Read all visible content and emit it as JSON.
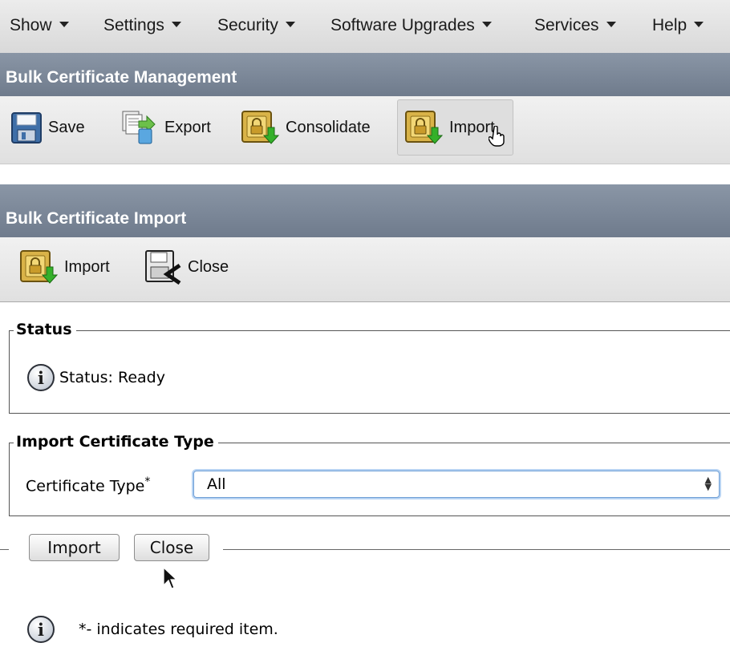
{
  "menu": {
    "items": [
      {
        "label": "Show"
      },
      {
        "label": "Settings"
      },
      {
        "label": "Security"
      },
      {
        "label": "Software Upgrades"
      },
      {
        "label": "Services"
      },
      {
        "label": "Help"
      }
    ]
  },
  "management": {
    "title": "Bulk Certificate Management",
    "toolbar": {
      "save_label": "Save",
      "export_label": "Export",
      "consolidate_label": "Consolidate",
      "import_label": "Import"
    }
  },
  "import_panel": {
    "title": "Bulk Certificate Import",
    "toolbar": {
      "import_label": "Import",
      "close_label": "Close"
    },
    "status_section": {
      "legend": "Status",
      "text": "Status: Ready"
    },
    "type_section": {
      "legend": "Import Certificate Type",
      "field_label": "Certificate Type",
      "required_marker": "*",
      "selected_value": "All"
    },
    "buttons": {
      "import_label": "Import",
      "close_label": "Close"
    },
    "footnote": "*- indicates required item."
  },
  "colors": {
    "titlebar": "#7a8697",
    "select_focus": "#6f9fd6"
  }
}
